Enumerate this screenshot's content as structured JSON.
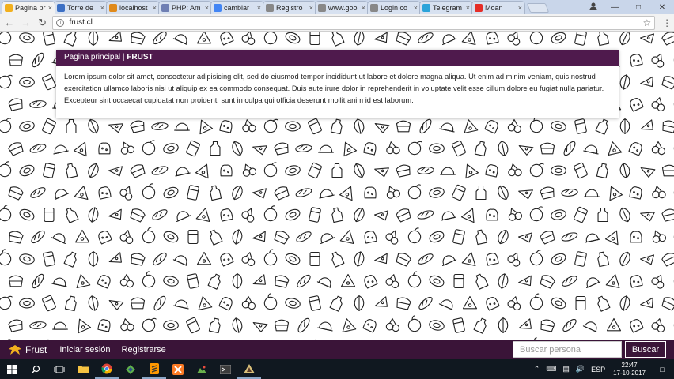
{
  "browser": {
    "tabs": [
      {
        "label": "Pagina pr",
        "icon": "folder-favicon",
        "color": "#f2b01e",
        "active": true
      },
      {
        "label": "Torre de",
        "icon": "site-favicon",
        "color": "#3b6fc4"
      },
      {
        "label": "localhost",
        "icon": "chart-favicon",
        "color": "#e08a1b"
      },
      {
        "label": "PHP: Am",
        "icon": "php-favicon",
        "color": "#6f7fb3"
      },
      {
        "label": "cambiar",
        "icon": "google-favicon",
        "color": "#4285f4"
      },
      {
        "label": "Registro",
        "icon": "page-favicon",
        "color": "#888888"
      },
      {
        "label": "www.goo",
        "icon": "page-favicon",
        "color": "#888888"
      },
      {
        "label": "Login co",
        "icon": "page-favicon",
        "color": "#888888"
      },
      {
        "label": "Telegram",
        "icon": "telegram-favicon",
        "color": "#2aa3d9"
      },
      {
        "label": "Moan",
        "icon": "youtube-favicon",
        "color": "#e52d27"
      }
    ],
    "url": "frust.cl"
  },
  "card": {
    "title_prefix": "Pagina principal | ",
    "title_brand": "FRUST",
    "body": "Lorem ipsum dolor sit amet, consectetur adipisicing elit, sed do eiusmod tempor incididunt ut labore et dolore magna aliqua. Ut enim ad minim veniam, quis nostrud exercitation ullamco laboris nisi ut aliquip ex ea commodo consequat. Duis aute irure dolor in reprehenderit in voluptate velit esse cillum dolore eu fugiat nulla pariatur. Excepteur sint occaecat cupidatat non proident, sunt in culpa qui officia deserunt mollit anim id est laborum."
  },
  "appbar": {
    "brand": "Frust",
    "login": "Iniciar sesión",
    "register": "Registrarse",
    "search_placeholder": "Buscar persona",
    "search_button": "Buscar",
    "colors": {
      "bar": "#3a1438",
      "header": "#4f1a4d",
      "brand_icon": "#f2b01e"
    }
  },
  "taskbar": {
    "language": "ESP",
    "time": "22:47",
    "date": "17-10-2017"
  }
}
